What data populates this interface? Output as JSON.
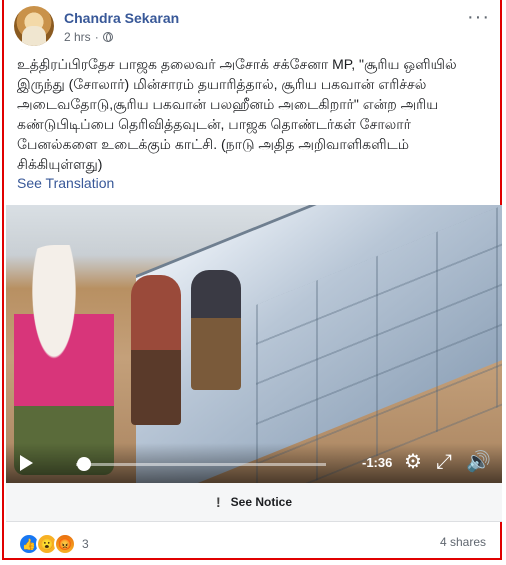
{
  "post": {
    "author": "Chandra Sekaran",
    "time": "2 hrs",
    "separator": "·",
    "menu_icon": "more-horizontal-icon",
    "text": "உத்திரப்பிரதேச பாஜக தலைவர் அசோக் சக்சேனா MP, \"சூரிய ஒளியில் இருந்து (சோலார்) மின்சாரம் தயாரித்தால், சூரிய பகவான் எரிச்சல் அடைவதோடு,சூரிய பகவான் பலஹீனம் அடைகிறார்\" என்ற அரிய கண்டுபிடிப்பை தெரிவித்தவுடன், பாஜக தொண்டர்கள் சோலார் பேனல்களை உடைக்கும் காட்சி. (நாடு அதித அறிவாளிகளிடம் சிக்கியுள்ளது)",
    "see_translation": "See Translation"
  },
  "video": {
    "time_remaining": "-1:36",
    "progress": 0.03,
    "icons": [
      "play-icon",
      "settings-icon",
      "fullscreen-icon",
      "volume-icon"
    ]
  },
  "notice": {
    "label": "See Notice",
    "icon": "exclamation-icon"
  },
  "footer": {
    "reactions": [
      "like",
      "wow",
      "angry"
    ],
    "reaction_count": "3",
    "shares": "4 shares"
  },
  "colors": {
    "link": "#385898",
    "frame_border": "#e00000",
    "like": "#1877f2"
  }
}
